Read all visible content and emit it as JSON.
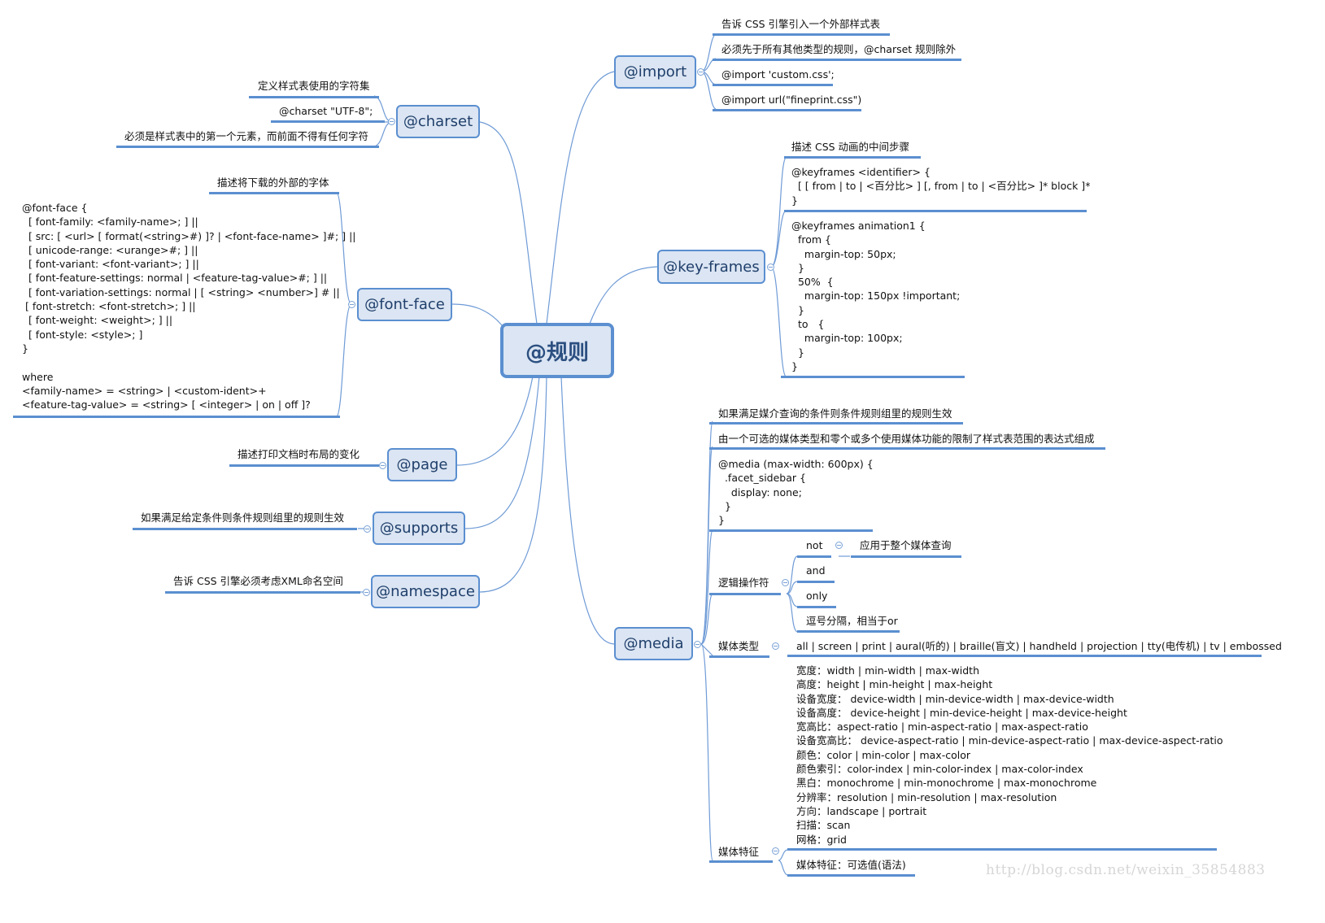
{
  "root": {
    "label": "@规则"
  },
  "branches": {
    "import": {
      "label": "@import",
      "items": [
        "告诉 CSS 引擎引入一个外部样式表",
        "必须先于所有其他类型的规则，@charset 规则除外",
        "@import 'custom.css';",
        "@import url(\"fineprint.css\")"
      ]
    },
    "charset": {
      "label": "@charset",
      "items": [
        "定义样式表使用的字符集",
        "@charset \"UTF-8\";",
        "必须是样式表中的第一个元素，而前面不得有任何字符"
      ]
    },
    "fontface": {
      "label": "@font-face",
      "description": "描述将下载的外部的字体",
      "syntax": "@font-face {\n  [ font-family: <family-name>; ] ||\n  [ src: [ <url> [ format(<string>#) ]? | <font-face-name> ]#; ] ||\n  [ unicode-range: <urange>#; ] ||\n  [ font-variant: <font-variant>; ] ||\n  [ font-feature-settings: normal | <feature-tag-value>#; ] ||\n  [ font-variation-settings: normal | [ <string> <number>] # ||\n [ font-stretch: <font-stretch>; ] ||\n  [ font-weight: <weight>; ] ||\n  [ font-style: <style>; ]\n}\n\nwhere\n<family-name> = <string> | <custom-ident>+\n<feature-tag-value> = <string> [ <integer> | on | off ]?"
    },
    "keyframes": {
      "label": "@key-frames",
      "description": "描述 CSS 动画的中间步骤",
      "syntax": "@keyframes <identifier> {\n  [ [ from | to | <百分比> ] [, from | to | <百分比> ]* block ]*\n}",
      "example": "@keyframes animation1 {\n  from {\n    margin-top: 50px;\n  }\n  50%  {\n    margin-top: 150px !important;\n  }\n  to   {\n    margin-top: 100px;\n  }\n}"
    },
    "page": {
      "label": "@page",
      "description": "描述打印文档时布局的变化"
    },
    "supports": {
      "label": "@supports",
      "description": "如果满足给定条件则条件规则组里的规则生效"
    },
    "namespace": {
      "label": "@namespace",
      "description": "告诉 CSS 引擎必须考虑XML命名空间"
    },
    "media": {
      "label": "@media",
      "description": "如果满足媒介查询的条件则条件规则组里的规则生效",
      "definition": "由一个可选的媒体类型和零个或多个使用媒体功能的限制了样式表范围的表达式组成",
      "example": "@media (max-width: 600px) {\n  .facet_sidebar {\n    display: none;\n  }\n}",
      "logic": {
        "label": "逻辑操作符",
        "operators": [
          "not",
          "and",
          "only",
          "逗号分隔，相当于or"
        ],
        "not_note": "应用于整个媒体查询"
      },
      "types": {
        "label": "媒体类型",
        "value": "all | screen | print | aural(听的) | braille(盲文) | handheld | projection | tty(电传机) | tv | embossed"
      },
      "features": {
        "label": "媒体特征",
        "list": "宽度：width | min-width | max-width\n高度：height | min-height | max-height\n设备宽度： device-width | min-device-width | max-device-width\n设备高度： device-height | min-device-height | max-device-height\n宽高比：aspect-ratio | min-aspect-ratio | max-aspect-ratio\n设备宽高比： device-aspect-ratio | min-device-aspect-ratio | max-device-aspect-ratio\n颜色：color | min-color | max-color\n颜色索引：color-index | min-color-index | max-color-index\n黑白：monochrome | min-monochrome | max-monochrome\n分辨率：resolution | min-resolution | max-resolution\n方向：landscape | portrait\n扫描：scan\n网格：grid",
        "optional": "媒体特征：可选值(语法)"
      }
    }
  },
  "watermark": "http://blog.csdn.net/weixin_35854883",
  "colors": {
    "accent": "#5b8fd0",
    "node_fill": "#dbe5f3",
    "node_text": "#1f3f6b"
  }
}
